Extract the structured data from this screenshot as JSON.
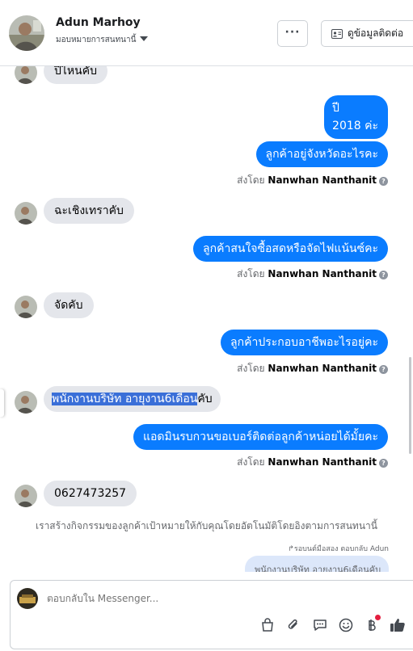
{
  "header": {
    "name": "Adun Marhoy",
    "assign_label": "มอบหมายการสนทนานี้",
    "more_label": "···",
    "contact_button_label": "ดูข้อมูลติดต่อ"
  },
  "messages": {
    "m1": "ปีไหนคับ",
    "m2_line1": "ปี",
    "m2_line2": "2018 ค่ะ",
    "m3": "ลูกค้าอยู่จังหวัดอะไรคะ",
    "m4": "ฉะเชิงเทราคับ",
    "m5": "ลูกค้าสนใจซื้อสดหรือจัดไฟแน้นซ์คะ",
    "m6": "จัดคับ",
    "m7": "ลูกค้าประกอบอาชีพอะไรอยู่คะ",
    "m8_selected": "พนักงานบริษัท อายุงาน6เดือน",
    "m8_rest": "คับ",
    "m9": "แอดมินรบกวนขอเบอร์ติดต่อลูกค้าหน่อยได้มั้ยคะ",
    "m10": "0627473257"
  },
  "sent_by": {
    "prefix": "ส่งโดย",
    "agent": "Nanwhan Nanthanit",
    "info": "?"
  },
  "system_note": "เราสร้างกิจกรรมของลูกค้าเป้าหมายให้กับคุณโดยอัตโนมัติโดยอิงตามการสนทนานี้",
  "reply": {
    "label": "↱รอบนต์มือสอง ตอบกลับ Adun",
    "quote": "พนักงานบริษัท อายุงาน6เดือนคับ"
  },
  "composer": {
    "placeholder": "ตอบกลับใน Messenger..."
  },
  "icons": {
    "more": "more-icon",
    "contact": "contact-card-icon",
    "shop": "shopping-bag-icon",
    "attach": "paperclip-icon",
    "saved_reply": "saved-reply-icon",
    "emoji": "emoji-icon",
    "payment": "baht-icon",
    "like": "thumbs-up-icon"
  },
  "colors": {
    "outgoing_bubble": "#0a7cff",
    "incoming_bubble": "#e4e6eb",
    "accent": "#1877f2",
    "notification": "#e41e3f"
  }
}
